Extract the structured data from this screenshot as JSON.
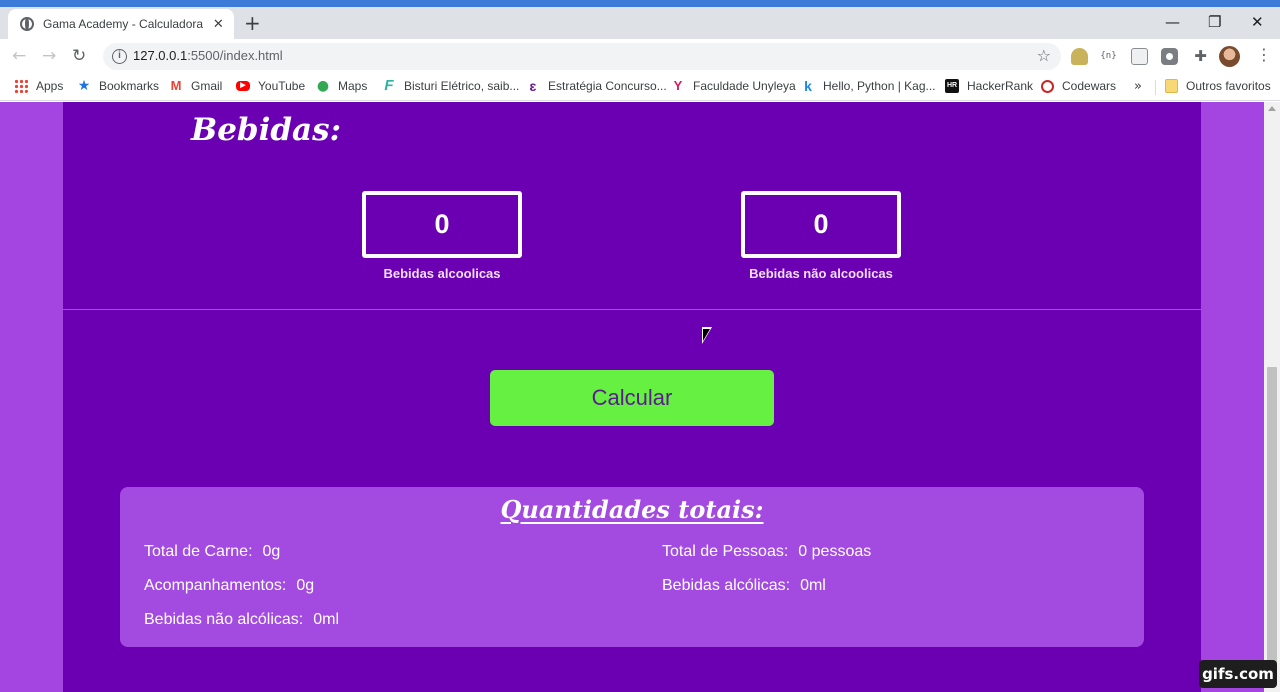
{
  "browser": {
    "tab_title": "Gama Academy - Calculadora de",
    "tab_close": "✕",
    "new_tab": "+",
    "window_controls": {
      "minimize": "—",
      "restore": "❐",
      "close": "✕"
    },
    "nav": {
      "back": "←",
      "forward": "→",
      "reload": "↻"
    },
    "url_host": "127.0.0.1",
    "url_path": ":5500/index.html",
    "star": "☆",
    "extension_code_label": "{n}",
    "extensions_puzzle": "✚",
    "menu": "⋮"
  },
  "bookmarks": {
    "items": [
      {
        "label": "Apps",
        "icon": "apps-grid-icon"
      },
      {
        "label": "Bookmarks",
        "icon": "star-icon"
      },
      {
        "label": "Gmail",
        "icon": "gmail-icon",
        "glyph": "M"
      },
      {
        "label": "YouTube",
        "icon": "youtube-icon",
        "glyph": "▶"
      },
      {
        "label": "Maps",
        "icon": "maps-pin-icon",
        "glyph": "●"
      },
      {
        "label": "Bisturi Elétrico, saib...",
        "icon": "f-logo-icon",
        "glyph": "F"
      },
      {
        "label": "Estratégia Concurso...",
        "icon": "estrategia-icon",
        "glyph": "ɛ"
      },
      {
        "label": "Faculdade Unyleya",
        "icon": "unyleya-icon",
        "glyph": "Y"
      },
      {
        "label": "Hello, Python | Kag...",
        "icon": "kaggle-icon",
        "glyph": "k"
      },
      {
        "label": "HackerRank",
        "icon": "hackerrank-icon",
        "glyph": "HR"
      },
      {
        "label": "Codewars",
        "icon": "codewars-icon",
        "glyph": ""
      }
    ],
    "more": "»",
    "other": "Outros favoritos"
  },
  "page": {
    "section_title": "Bebidas:",
    "alcoholic": {
      "value": "0",
      "label": "Bebidas alcoolicas"
    },
    "non_alcoholic": {
      "value": "0",
      "label": "Bebidas não alcoolicas"
    },
    "calculate_button": "Calcular",
    "results": {
      "title": "Quantidades totais:",
      "total_carne_label": "Total de Carne:",
      "total_carne_value": "0g",
      "acompanhamentos_label": "Acompanhamentos:",
      "acompanhamentos_value": "0g",
      "nao_alcoolicas_label": "Bebidas não alcólicas:",
      "nao_alcoolicas_value": "0ml",
      "total_pessoas_label": "Total de Pessoas:",
      "total_pessoas_value": "0 pessoas",
      "alcoolicas_label": "Bebidas alcólicas:",
      "alcoolicas_value": "0ml"
    }
  },
  "watermark": "gifs.com",
  "colors": {
    "page_bg": "#a445e2",
    "panel_bg": "#6a00b2",
    "button_bg": "#65f042",
    "results_bg": "#a34ae0"
  }
}
